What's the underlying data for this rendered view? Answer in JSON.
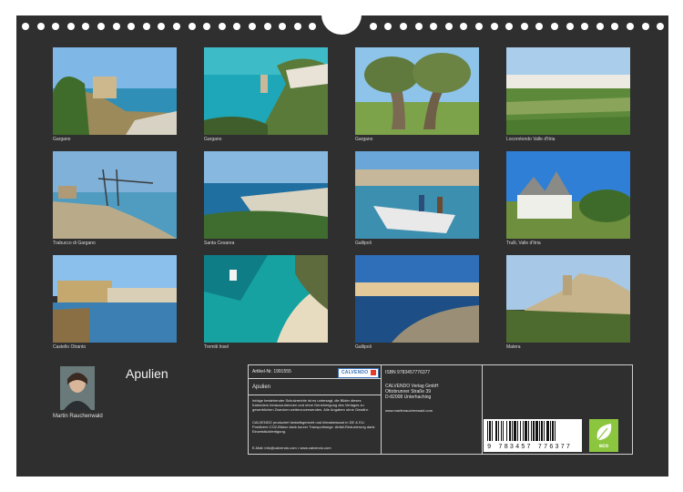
{
  "title": "Apulien",
  "author": "Martin Rauchenwald",
  "photos": [
    {
      "caption": "Gargano"
    },
    {
      "caption": "Gargano"
    },
    {
      "caption": "Gargano"
    },
    {
      "caption": "Locorotondo Valle d'Itria"
    },
    {
      "caption": "Trabucco di Gargano"
    },
    {
      "caption": "Santa Cesarea"
    },
    {
      "caption": "Gallipoli"
    },
    {
      "caption": "Trulli, Valle d'Itria"
    },
    {
      "caption": "Castello Otranto"
    },
    {
      "caption": "Tremiti Insel"
    },
    {
      "caption": "Gallipoli"
    },
    {
      "caption": "Matera"
    }
  ],
  "info": {
    "article": "Artikel-Nr. 1991555",
    "product_title": "Apulien",
    "copyright": "Infolge bestehender Schutzrechte ist es untersagt, die Bilder dieses Kalenders herauszutrennen und ohne Genehmigung des Verlages zu gewerblichen Zwecken weiterzuverwenden. Alle Angaben ohne Gewähr.",
    "producer": "CALVENDO produziert bedarfsgerecht und klimabewusst in DE & EU. Positivere CO2-Bilanz dank kurzer Transportwege. Abfall-Reduzierung dank Einzelstückfertigung.",
    "contact": "E-Mail: info@calvendo.com • www.calvendo.com",
    "logo": "CALVENDO",
    "isbn": "ISBN 9783457776377",
    "publisher_name": "CALVENDO Verlag GmbH",
    "publisher_street": "Ottobrunner Straße 39",
    "publisher_city": "D-82008 Unterhaching",
    "publisher_web": "www.martinrauchenwald.com",
    "barcode_number": "9 783457 776377",
    "eco_label": "eco"
  }
}
